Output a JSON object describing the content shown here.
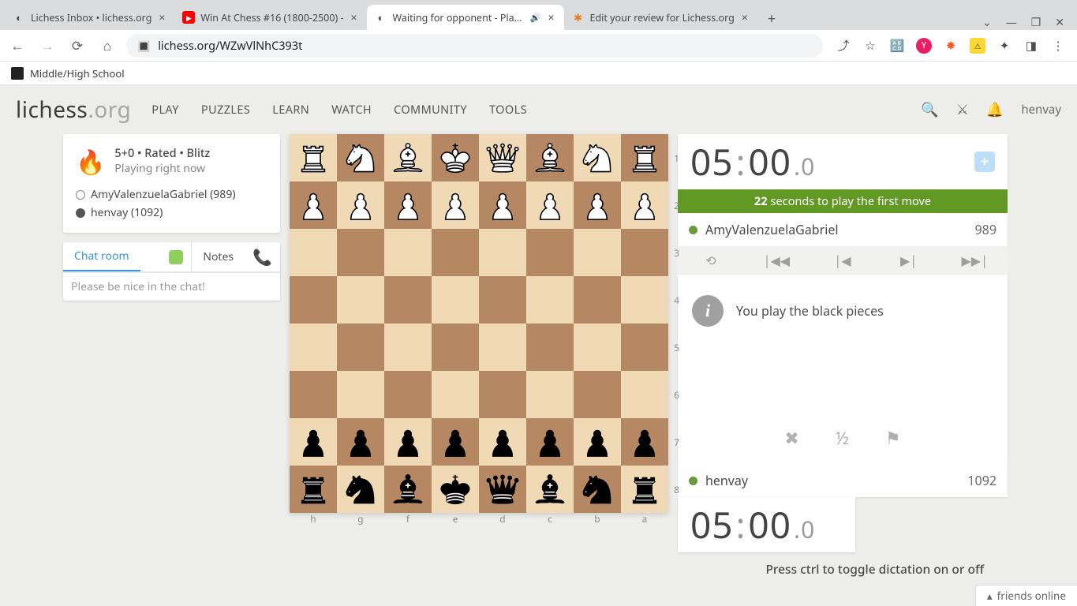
{
  "browser": {
    "tabs": [
      {
        "title": "Lichess Inbox • lichess.org",
        "favicon": "◐"
      },
      {
        "title": "Win At Chess #16 (1800-2500) -",
        "favicon": "▶"
      },
      {
        "title": "Waiting for opponent - Play A",
        "favicon": "◐",
        "audio": "🔊",
        "active": true
      },
      {
        "title": "Edit your review for Lichess.org",
        "favicon": "✱"
      }
    ],
    "url": "lichess.org/WZwVlNhC393t",
    "bookmark": "Middle/High School"
  },
  "lichess": {
    "logo_main": "lichess",
    "logo_suffix": ".org",
    "nav": [
      "PLAY",
      "PUZZLES",
      "LEARN",
      "WATCH",
      "COMMUNITY",
      "TOOLS"
    ],
    "username": "henvay"
  },
  "game_info": {
    "line1": "5+0 • Rated • Blitz",
    "line2": "Playing right now",
    "opponent": "AmyValenzuelaGabriel (989)",
    "self": "henvay (1092)"
  },
  "chat": {
    "tab_room": "Chat room",
    "tab_notes": "Notes",
    "placeholder": "Please be nice in the chat!"
  },
  "board": {
    "ranks": [
      "1",
      "2",
      "3",
      "4",
      "5",
      "6",
      "7",
      "8"
    ],
    "files": [
      "h",
      "g",
      "f",
      "e",
      "d",
      "c",
      "b",
      "a"
    ]
  },
  "clock": {
    "top": "05:00.0",
    "bottom": "05:00.0",
    "seconds_left": "22",
    "first_move_text": "seconds to play the first move"
  },
  "players": {
    "top_name": "AmyValenzuelaGabriel",
    "top_rating": "989",
    "bottom_name": "henvay",
    "bottom_rating": "1092"
  },
  "info_message": "You play the black pieces",
  "actions": {
    "half": "½"
  },
  "dictation": "Press ctrl to toggle dictation on or off",
  "friends": "friends online"
}
